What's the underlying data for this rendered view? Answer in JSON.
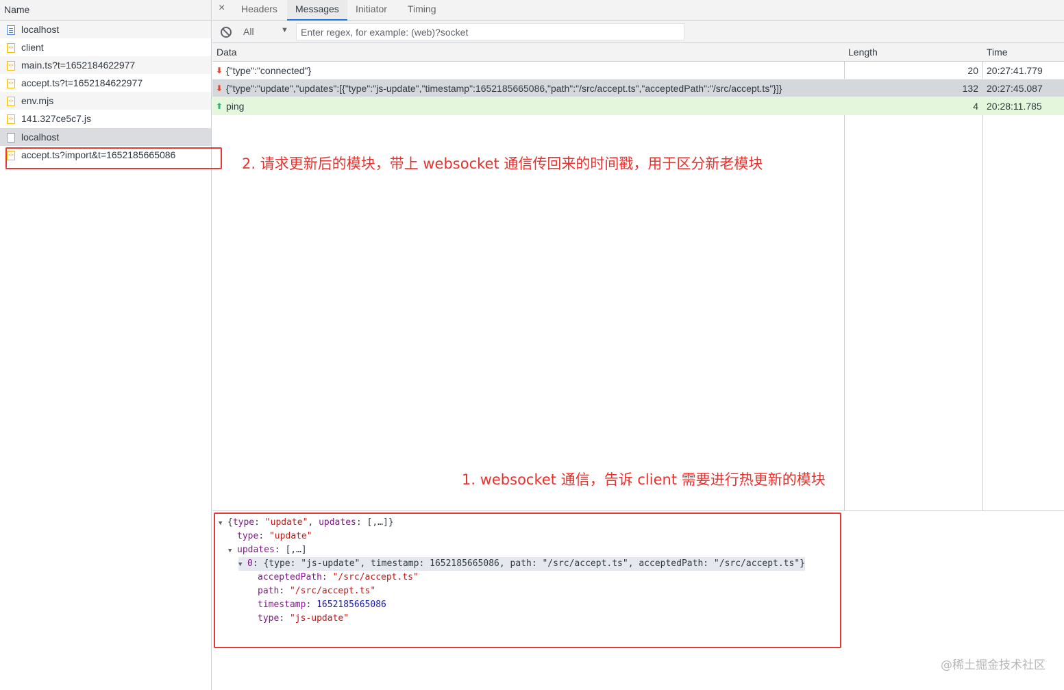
{
  "left_panel": {
    "header": "Name",
    "requests": [
      {
        "name": "localhost",
        "icon": "document-icon"
      },
      {
        "name": "client",
        "icon": "script-icon"
      },
      {
        "name": "main.ts?t=1652184622977",
        "icon": "script-icon"
      },
      {
        "name": "accept.ts?t=1652184622977",
        "icon": "script-icon"
      },
      {
        "name": "env.mjs",
        "icon": "script-icon"
      },
      {
        "name": "141.327ce5c7.js",
        "icon": "script-icon"
      },
      {
        "name": "localhost",
        "icon": "websocket-icon"
      },
      {
        "name": "accept.ts?import&t=1652185665086",
        "icon": "script-icon"
      }
    ]
  },
  "tabs": {
    "close": "×",
    "headers": "Headers",
    "messages": "Messages",
    "initiator": "Initiator",
    "timing": "Timing"
  },
  "filter": {
    "type_selected": "All",
    "regex_placeholder": "Enter regex, for example: (web)?socket"
  },
  "grid": {
    "columns": {
      "data": "Data",
      "length": "Length",
      "time": "Time"
    },
    "rows": [
      {
        "direction": "received",
        "arrow": "⬇",
        "data": "{\"type\":\"connected\"}",
        "length": "20",
        "time": "20:27:41.779"
      },
      {
        "direction": "received",
        "arrow": "⬇",
        "data": "{\"type\":\"update\",\"updates\":[{\"type\":\"js-update\",\"timestamp\":1652185665086,\"path\":\"/src/accept.ts\",\"acceptedPath\":\"/src/accept.ts\"}]}",
        "length": "132",
        "time": "20:27:45.087"
      },
      {
        "direction": "sent",
        "arrow": "⬆",
        "data": "ping",
        "length": "4",
        "time": "20:28:11.785"
      }
    ]
  },
  "detail": {
    "root_summary_key1": "type",
    "root_summary_val1": "\"update\"",
    "root_summary_key2": "updates",
    "root_summary_val2": "[,…]",
    "type_key": "type",
    "type_val": "\"update\"",
    "updates_key": "updates",
    "updates_val": "[,…]",
    "item0_key": "0",
    "item0_summary": "{type: \"js-update\", timestamp: 1652185665086, path: \"/src/accept.ts\", acceptedPath: \"/src/accept.ts\"}",
    "acceptedPath_key": "acceptedPath",
    "acceptedPath_val": "\"/src/accept.ts\"",
    "path_key": "path",
    "path_val": "\"/src/accept.ts\"",
    "timestamp_key": "timestamp",
    "timestamp_val": "1652185665086",
    "itype_key": "type",
    "itype_val": "\"js-update\""
  },
  "annotations": {
    "note2": "2. 请求更新后的模块，带上 websocket 通信传回来的时间戳，用于区分新老模块",
    "note1": "1. websocket 通信，告诉 client 需要进行热更新的模块"
  },
  "watermark": "@稀土掘金技术社区",
  "colors": {
    "annotation_red": "#e53935",
    "selected_row": "#d4d7db",
    "ping_row": "#e4f6dc",
    "tab_accent": "#1a73e8"
  }
}
